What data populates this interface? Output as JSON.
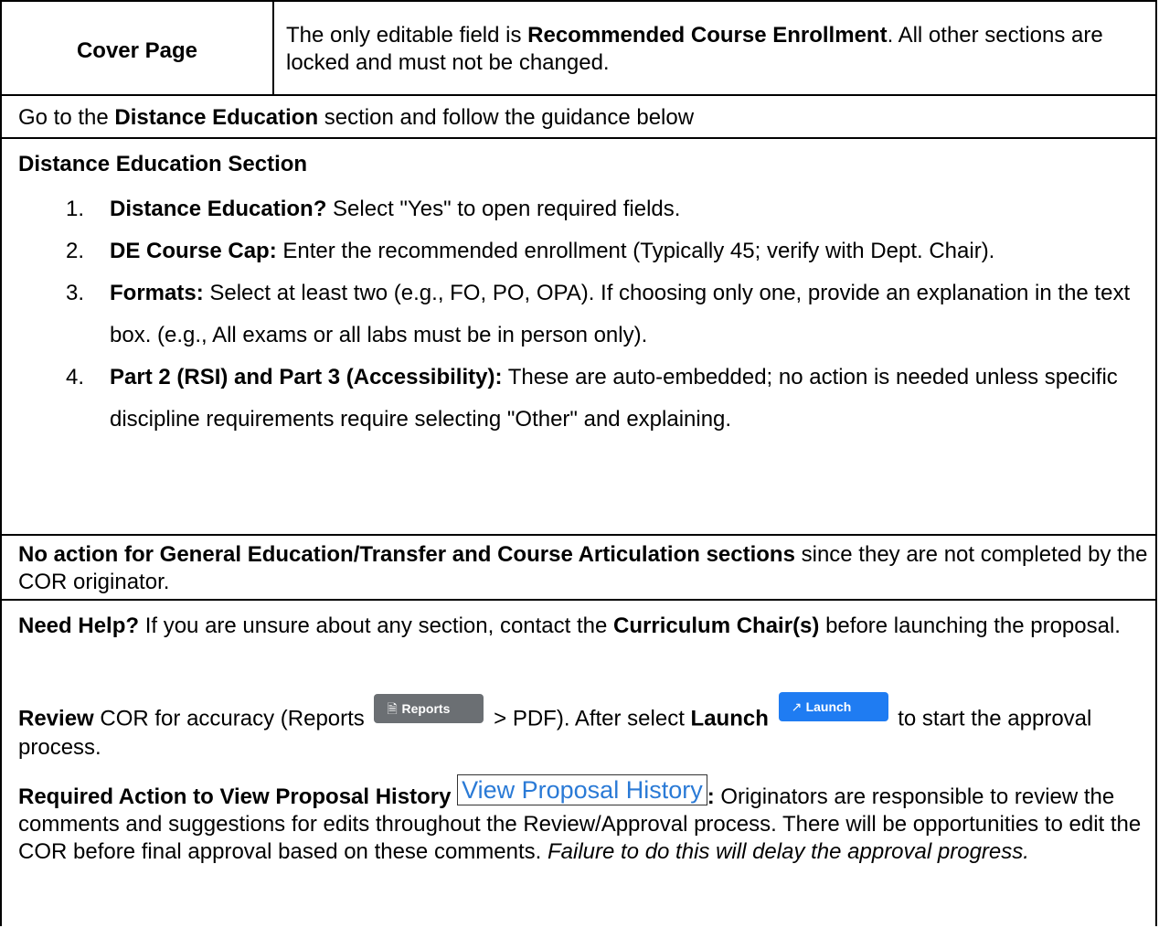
{
  "cover": {
    "label": "Cover Page",
    "desc_1": "The only editable field is ",
    "desc_bold": "Recommended Course Enrollment",
    "desc_2": ". All other sections are locked and must not be changed."
  },
  "go": {
    "t1": "Go to the ",
    "bold": "Distance Education",
    "t2": " section and follow the guidance below"
  },
  "de": {
    "title": "Distance Education Section",
    "items": [
      {
        "num": "1.",
        "bold": "Distance Education?",
        "text": " Select \"Yes\" to open required fields."
      },
      {
        "num": "2.",
        "bold": "DE Course Cap:",
        "text": " Enter the recommended enrollment (Typically 45; verify with Dept. Chair)."
      },
      {
        "num": "3.",
        "bold": "Formats:",
        "text": " Select at least two (e.g., FO, PO, OPA). If choosing only one, provide an explanation in the text box. (e.g., All exams or all labs must be in person only)."
      },
      {
        "num": "4.",
        "bold": "Part 2 (RSI) and Part 3 (Accessibility):",
        "text": " These are auto-embedded; no action is needed unless specific discipline requirements require selecting \"Other\" and explaining."
      }
    ]
  },
  "ge": {
    "bold": "No action for General Education/Transfer and Course Articulation sections",
    "text": " since they are not completed by the COR originator."
  },
  "help": {
    "bold1": "Need Help?",
    "t1": " If you are unsure about any section, contact the ",
    "bold2": "Curriculum Chair(s)",
    "t2": " before launching the proposal."
  },
  "review": {
    "bold1": "Review",
    "t1": " COR for accuracy (Reports ",
    "t2": " > PDF). After select ",
    "bold2": "Launch",
    "t3": " to start the approval process.",
    "reports_button": "Reports",
    "launch_button": "Launch"
  },
  "history": {
    "bold": "Required Action to View Proposal History",
    "button": "View Proposal History",
    "colon": ":",
    "t1": " Originators are responsible to review the comments and suggestions for edits throughout the Review/Approval process. There will be opportunities to edit the COR before final approval based on these comments. ",
    "italic": "Failure to do this will delay the approval progress."
  },
  "icons": {
    "reports_icon": "document-icon",
    "launch_icon": "arrow-up-right-icon"
  },
  "colors": {
    "reports_button_bg": "#6b6f73",
    "launch_button_bg": "#1f7cf2",
    "history_link": "#2a7ad6"
  }
}
